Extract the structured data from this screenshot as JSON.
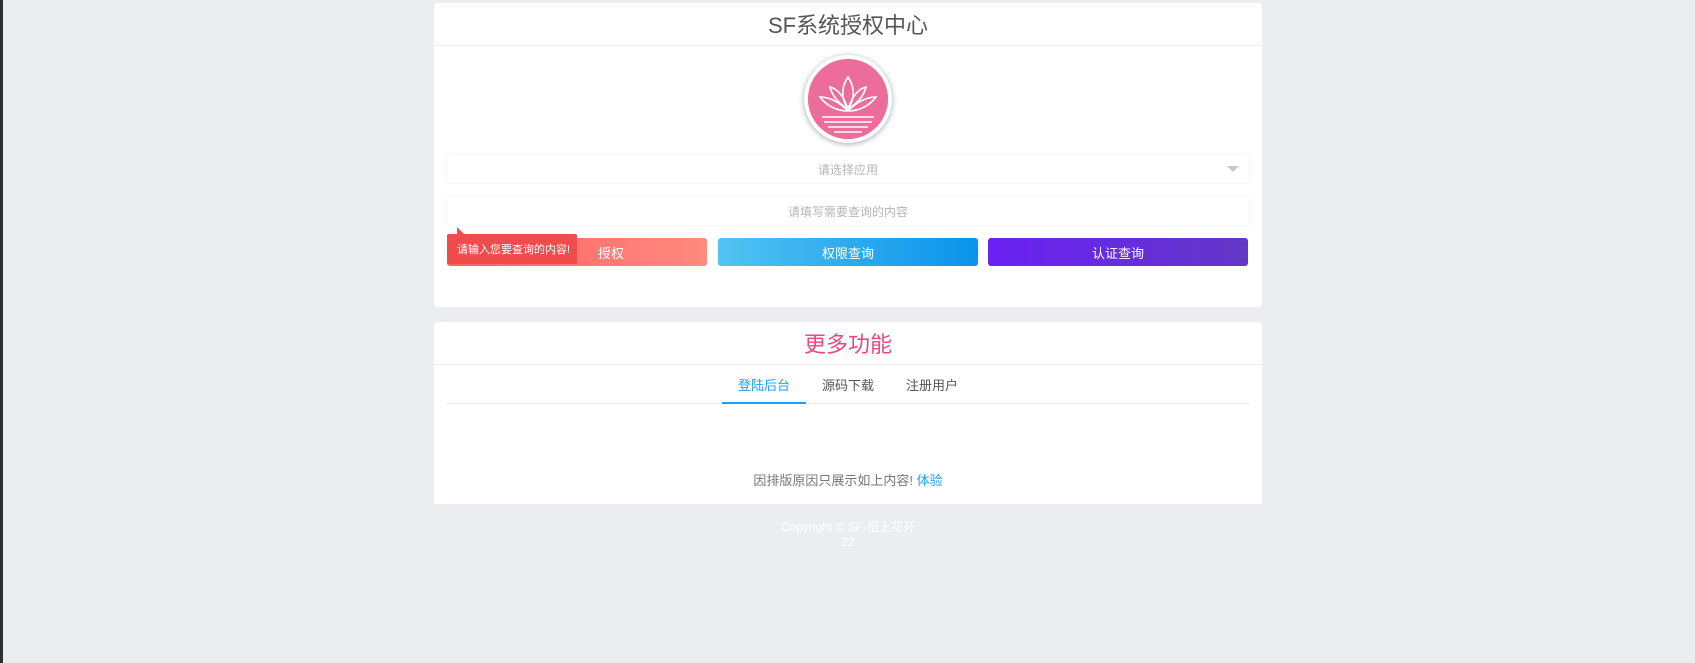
{
  "auth_card": {
    "title": "SF系统授权中心",
    "select_placeholder": "请选择应用",
    "input_placeholder": "请填写需要查询的内容",
    "buttons": {
      "auth_label": "授权",
      "perm_label": "权限查询",
      "cert_label": "认证查询"
    },
    "tooltip": "请输入您要查询的内容!"
  },
  "more_card": {
    "title": "更多功能",
    "tabs": [
      {
        "label": "登陆后台"
      },
      {
        "label": "源码下载"
      },
      {
        "label": "注册用户"
      }
    ],
    "note_text": "因排版原因只展示如上内容!",
    "note_link": "体验"
  },
  "footer": {
    "copyright": "Copyright © SF-稻上花开",
    "number": "22"
  },
  "colors": {
    "accent_blue": "#1e9fff",
    "title_pink": "#e84a7f",
    "tooltip_red": "#f24b4b"
  }
}
